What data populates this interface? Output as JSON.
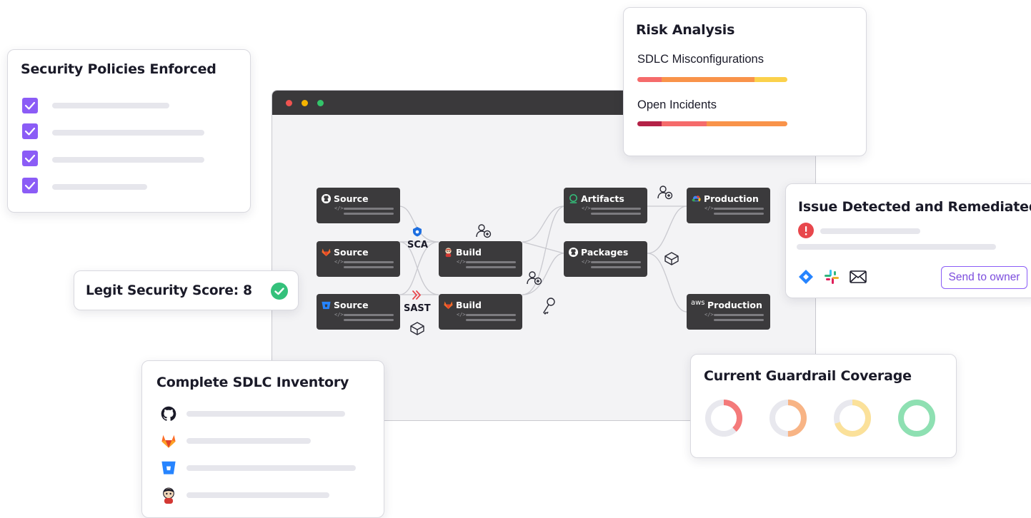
{
  "colors": {
    "accent_purple": "#8b5cf6",
    "window_titlebar": "#3a393b",
    "node_bg": "#3b3a3c",
    "success_green": "#34c17b",
    "alert_red": "#e8474c"
  },
  "browser": {
    "window_dots": [
      "#ef5350",
      "#f5b400",
      "#33c46a"
    ],
    "nodes": [
      {
        "label": "Source",
        "icon": "github-icon"
      },
      {
        "label": "Source",
        "icon": "gitlab-icon"
      },
      {
        "label": "Source",
        "icon": "bitbucket-icon"
      },
      {
        "label": "Build",
        "icon": "jenkins-icon"
      },
      {
        "label": "Build",
        "icon": "gitlab-icon"
      },
      {
        "label": "Artifacts",
        "icon": "artifacts-icon"
      },
      {
        "label": "Packages",
        "icon": "github-icon"
      },
      {
        "label": "Production",
        "icon": "gcp-icon"
      },
      {
        "label": "Production",
        "icon": "aws-icon"
      }
    ],
    "code_glyph": "</>",
    "aws_text": "aws",
    "sca_label": "SCA",
    "sast_label": "SAST"
  },
  "policies": {
    "title": "Security Policies Enforced",
    "items_checked": [
      true,
      true,
      true,
      true
    ]
  },
  "risk": {
    "title": "Risk Analysis",
    "metrics": [
      {
        "label": "SDLC Misconfigurations",
        "segments": [
          {
            "color": "#f56b6b",
            "share": 0.16
          },
          {
            "color": "#f9934a",
            "share": 0.62
          },
          {
            "color": "#fbd14b",
            "share": 0.22
          }
        ]
      },
      {
        "label": "Open Incidents",
        "segments": [
          {
            "color": "#b42247",
            "share": 0.16
          },
          {
            "color": "#f56b6b",
            "share": 0.3
          },
          {
            "color": "#f9934a",
            "share": 0.54
          }
        ]
      }
    ]
  },
  "issue": {
    "title": "Issue Detected and Remediated",
    "alert_icon": "alert-icon",
    "integrations": [
      "jira-icon",
      "slack-icon",
      "mail-icon"
    ],
    "send_button": "Send to owner"
  },
  "score": {
    "label": "Legit Security Score: 8",
    "status_icon": "check-circle-icon"
  },
  "inventory": {
    "title": "Complete SDLC Inventory",
    "items": [
      "github-icon",
      "gitlab-icon",
      "bitbucket-icon",
      "jenkins-icon"
    ]
  },
  "guardrail": {
    "title": "Current Guardrail Coverage",
    "rings": [
      {
        "color": "#f47a7a",
        "fraction": 0.38
      },
      {
        "color": "#f8b485",
        "fraction": 0.5
      },
      {
        "color": "#fbe19a",
        "fraction": 0.7
      },
      {
        "color": "#8ee0b2",
        "fraction": 1.0
      }
    ]
  }
}
